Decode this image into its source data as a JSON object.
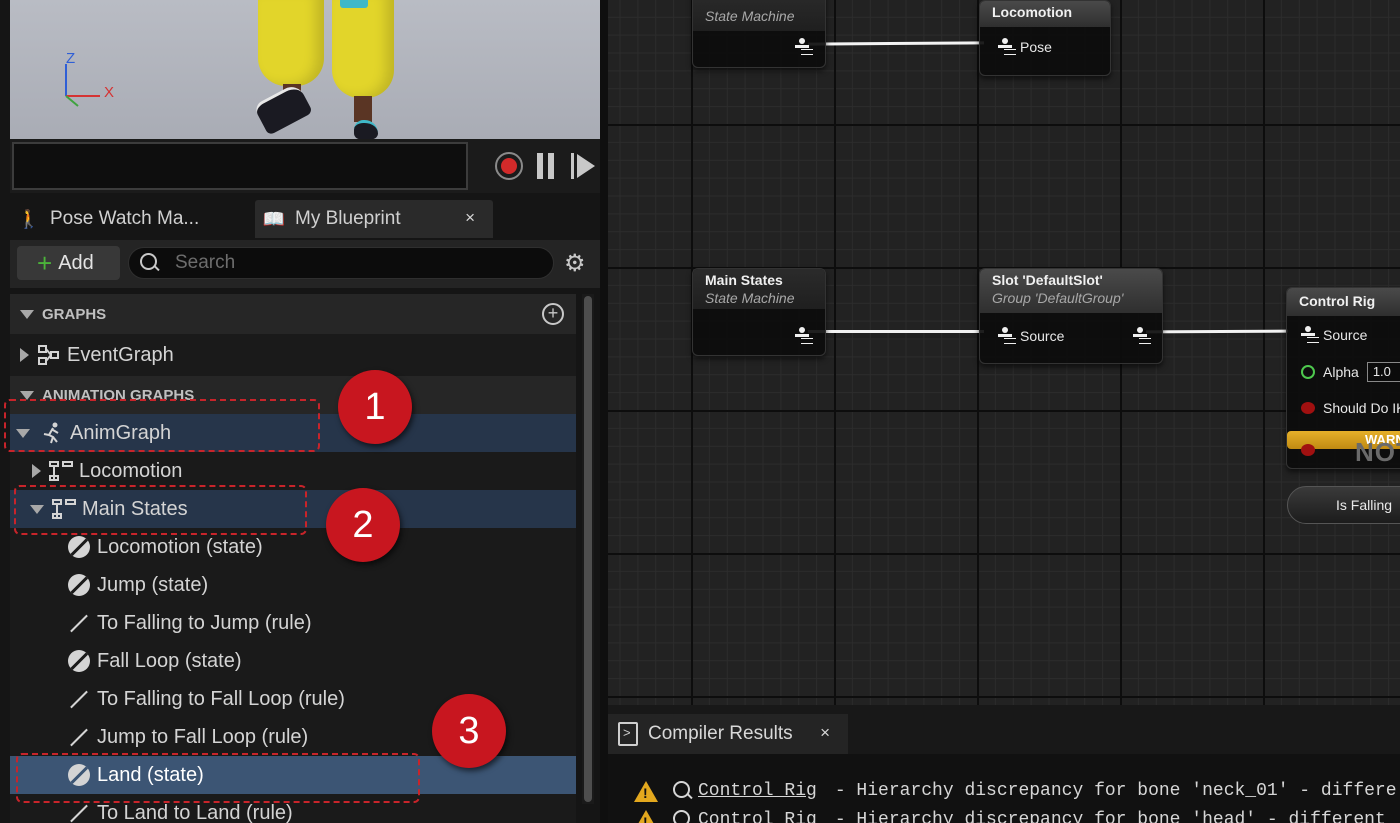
{
  "viewport": {
    "axis_z": "Z",
    "axis_x": "X"
  },
  "panel_tabs": [
    {
      "label": "Pose Watch Ma..."
    },
    {
      "label": "My Blueprint",
      "close": "×"
    }
  ],
  "toolbar": {
    "add_label": "Add",
    "search_placeholder": "Search"
  },
  "tree": {
    "graphs_header": "GRAPHS",
    "event_graph": "EventGraph",
    "anim_graphs_header": "ANIMATION GRAPHS",
    "anim_graph": "AnimGraph",
    "locomotion": "Locomotion",
    "main_states": "Main States",
    "items": [
      {
        "label": "Locomotion (state)",
        "kind": "state"
      },
      {
        "label": "Jump (state)",
        "kind": "state"
      },
      {
        "label": "To Falling to Jump (rule)",
        "kind": "rule"
      },
      {
        "label": "Fall Loop (state)",
        "kind": "state"
      },
      {
        "label": "To Falling to Fall Loop (rule)",
        "kind": "rule"
      },
      {
        "label": "Jump to Fall Loop (rule)",
        "kind": "rule"
      },
      {
        "label": "Land (state)",
        "kind": "state"
      },
      {
        "label": "To Land to Land (rule)",
        "kind": "rule"
      }
    ]
  },
  "annotations": [
    "1",
    "2",
    "3"
  ],
  "graph": {
    "node_sm_top": {
      "subtitle": "State Machine"
    },
    "node_locomotion": {
      "title": "Locomotion",
      "pin": "Pose"
    },
    "node_main_states": {
      "title": "Main States",
      "subtitle": "State Machine"
    },
    "node_slot": {
      "title": "Slot 'DefaultSlot'",
      "subtitle": "Group 'DefaultGroup'",
      "pin": "Source"
    },
    "node_control_rig": {
      "title": "Control Rig",
      "pin_source": "Source",
      "pin_alpha": "Alpha",
      "alpha_value": "1.0",
      "pin_should": "Should Do IK",
      "warning": "WARN",
      "note": "NOTE"
    },
    "is_falling": "Is Falling"
  },
  "compiler": {
    "tab_label": "Compiler Results",
    "close": "×",
    "messages": [
      {
        "link": "Control Rig",
        "text": "- Hierarchy discrepancy for bone 'neck_01' - differe"
      },
      {
        "link": "Control Rig",
        "text": "- Hierarchy discrepancy for bone 'head' - different"
      }
    ]
  }
}
